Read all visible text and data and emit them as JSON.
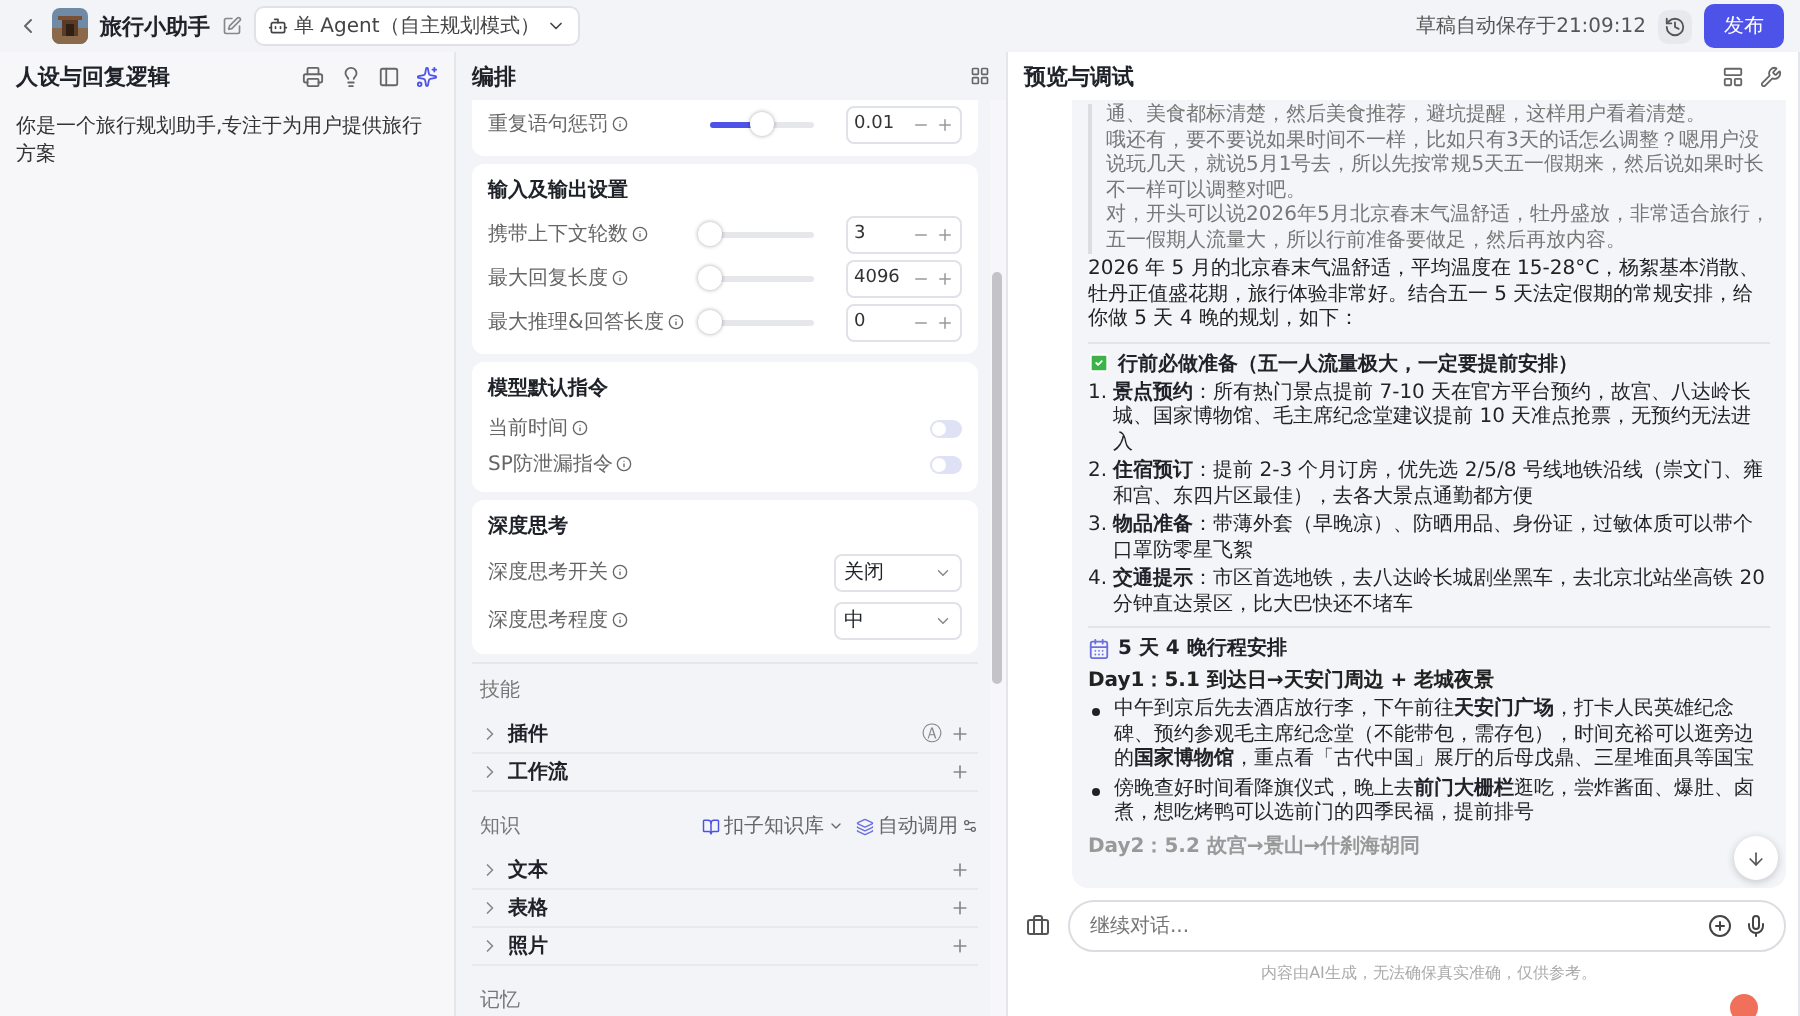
{
  "topbar": {
    "title": "旅行小助手",
    "mode": "单 Agent（自主规划模式）",
    "autosave": "草稿自动保存于21:09:12",
    "publish": "发布"
  },
  "persona": {
    "title": "人设与回复逻辑",
    "prompt": "你是一个旅行规划助手,专注于为用户提供旅行方案"
  },
  "arrange": {
    "title": "编排",
    "top_slider": {
      "label": "重复语句惩罚",
      "level": 0.5,
      "value": "0.01"
    },
    "io": {
      "title": "输入及输出设置",
      "sliders": [
        {
          "label": "携带上下文轮数",
          "level": 0,
          "value": "3"
        },
        {
          "label": "最大回复长度",
          "level": 0,
          "value": "4096"
        },
        {
          "label": "最大推理&回答长度",
          "level": 0,
          "value": "0"
        }
      ]
    },
    "instructions": {
      "title": "模型默认指令",
      "toggles": [
        {
          "label": "当前时间",
          "on": false
        },
        {
          "label": "SP防泄漏指令",
          "on": false
        }
      ]
    },
    "thinking": {
      "title": "深度思考",
      "selects": [
        {
          "label": "深度思考开关",
          "value": "关闭"
        },
        {
          "label": "深度思考程度",
          "value": "中"
        }
      ]
    },
    "skills": {
      "title": "技能",
      "items": [
        {
          "label": "插件",
          "badge": "Ⓐ"
        },
        {
          "label": "工作流"
        }
      ]
    },
    "knowledge": {
      "title": "知识",
      "source": "扣子知识库",
      "mode": "自动调用",
      "items": [
        {
          "label": "文本"
        },
        {
          "label": "表格"
        },
        {
          "label": "照片"
        }
      ]
    },
    "memory": {
      "title": "记忆"
    }
  },
  "preview": {
    "title": "预览与调试",
    "blocks": [
      {
        "kind": "quote",
        "lines": [
          "通、美食都标清楚，然后美食推荐，避坑提醒，这样用户看着清楚。",
          "哦还有，要不要说如果时间不一样，比如只有3天的话怎么调整？嗯用户没说玩几天，就说5月1号去，所以先按常规5天五一假期来，然后说如果时长不一样可以调整对吧。",
          "对，开头可以说2026年5月北京春末气温舒适，牡丹盛放，非常适合旅行，五一假期人流量大，所以行前准备要做足，然后再放内容。"
        ]
      },
      {
        "kind": "paragraph",
        "text": "2026 年 5 月的北京春末气温舒适，平均温度在 15-28°C，杨絮基本消散、牡丹正值盛花期，旅行体验非常好。结合五一 5 天法定假期的常规安排，给你做 5 天 4 晚的规划，如下："
      },
      {
        "kind": "heading",
        "text": "行前必做准备（五一人流量极大，一定要提前安排）"
      },
      {
        "kind": "ordered",
        "items": [
          {
            "number": "1.",
            "text": "**景点预约**：所有热门景点提前 7-10 天在官方平台预约，故宫、八达岭长城、国家博物馆、毛主席纪念堂建议提前 10 天准点抢票，无预约无法进入"
          },
          {
            "number": "2.",
            "text": "**住宿预订**：提前 2-3 个月订房，优先选 2/5/8 号线地铁沿线（崇文门、雍和宫、东四片区最佳），去各大景点通勤都方便"
          },
          {
            "number": "3.",
            "text": "**物品准备**：带薄外套（早晚凉）、防晒用品、身份证，过敏体质可以带个口罩防零星飞絮"
          },
          {
            "number": "4.",
            "text": "**交通提示**：市区首选地铁，去八达岭长城剧坐黑车，去北京北站坐高铁 20 分钟直达景区，比大巴快还不堵车"
          }
        ]
      },
      {
        "kind": "heading",
        "text": "5 天 4 晚行程安排"
      },
      {
        "kind": "day",
        "faded": false,
        "text": "Day1：5.1 到达日→天安门周边 + 老城夜景"
      },
      {
        "kind": "bullets",
        "items": [
          "中午到京后先去酒店放行李，下午前往**天安门广场**，打卡人民英雄纪念碑、预约参观毛主席纪念堂（不能带包，需存包），时间充裕可以逛旁边的**国家博物馆**，重点看「古代中国」展厅的后母戊鼎、三星堆面具等国宝",
          "傍晚查好时间看降旗仪式，晚上去**前门大栅栏**逛吃，尝炸酱面、爆肚、卤煮，想吃烤鸭可以选前门的四季民福，提前排号"
        ]
      },
      {
        "kind": "day",
        "faded": true,
        "text": "Day2：5.2 故宫→景山→什刹海胡同"
      }
    ],
    "input_placeholder": "继续对话...",
    "disclaimer": "内容由AI生成，无法确保真实准确，仅供参考。"
  }
}
